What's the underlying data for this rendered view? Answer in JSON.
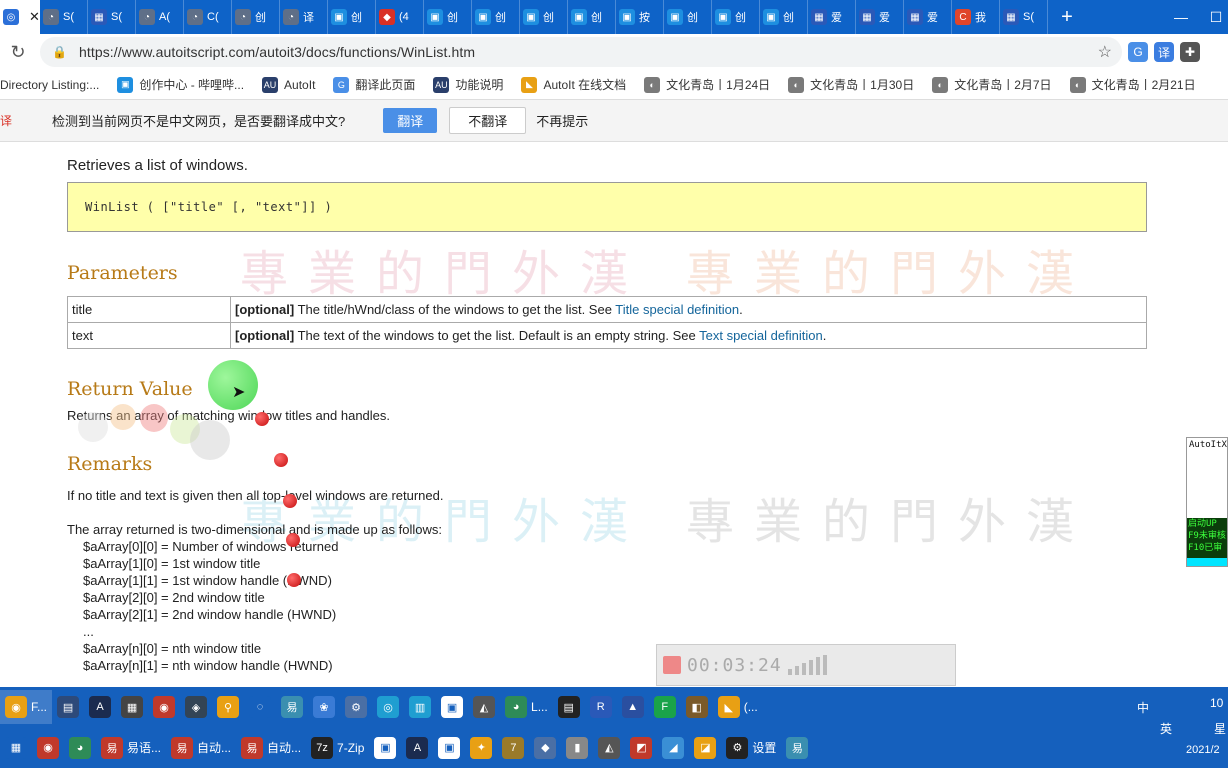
{
  "tabs": [
    {
      "title": "",
      "active": true,
      "color": "#2b6fd8",
      "glyph": "◎",
      "width": 40
    },
    {
      "title": "S(",
      "color": "#5f6f88",
      "glyph": "◔",
      "width": 48
    },
    {
      "title": "S(",
      "color": "#2a59b8",
      "glyph": "▦",
      "width": 48
    },
    {
      "title": "A(",
      "color": "#5f6f88",
      "glyph": "◔",
      "width": 48
    },
    {
      "title": "C(",
      "color": "#5f6f88",
      "glyph": "◔",
      "width": 48
    },
    {
      "title": "创",
      "color": "#5f6f88",
      "glyph": "◔",
      "width": 48
    },
    {
      "title": "译",
      "color": "#5f6f88",
      "glyph": "◔",
      "width": 48
    },
    {
      "title": "创",
      "color": "#1e8fe0",
      "glyph": "▣",
      "width": 48
    },
    {
      "title": "(4",
      "color": "#d93025",
      "glyph": "◆",
      "width": 48
    },
    {
      "title": "创",
      "color": "#1e8fe0",
      "glyph": "▣",
      "width": 48
    },
    {
      "title": "创",
      "color": "#1e8fe0",
      "glyph": "▣",
      "width": 48
    },
    {
      "title": "创",
      "color": "#1e8fe0",
      "glyph": "▣",
      "width": 48
    },
    {
      "title": "创",
      "color": "#1e8fe0",
      "glyph": "▣",
      "width": 48
    },
    {
      "title": "按",
      "color": "#1e8fe0",
      "glyph": "▣",
      "width": 48
    },
    {
      "title": "创",
      "color": "#1e8fe0",
      "glyph": "▣",
      "width": 48
    },
    {
      "title": "创",
      "color": "#1e8fe0",
      "glyph": "▣",
      "width": 48
    },
    {
      "title": "创",
      "color": "#1e8fe0",
      "glyph": "▣",
      "width": 48
    },
    {
      "title": "爱",
      "color": "#2a59b8",
      "glyph": "▦",
      "width": 48
    },
    {
      "title": "爱",
      "color": "#2a59b8",
      "glyph": "▦",
      "width": 48
    },
    {
      "title": "爱",
      "color": "#2a59b8",
      "glyph": "▦",
      "width": 48
    },
    {
      "title": "我",
      "color": "#e0452a",
      "glyph": "C",
      "width": 48
    },
    {
      "title": "S(",
      "color": "#2a59b8",
      "glyph": "▦",
      "width": 48
    }
  ],
  "window_controls": {
    "minimize": "—",
    "maximize": "☐"
  },
  "address": {
    "url": "https://www.autoitscript.com/autoit3/docs/functions/WinList.htm",
    "lock_glyph": "🔒",
    "reload_glyph": "↻",
    "star_glyph": "☆"
  },
  "extensions": [
    {
      "glyph": "G",
      "color": "#4a8fe7"
    },
    {
      "glyph": "译",
      "color": "#3b7de0"
    },
    {
      "glyph": "✚",
      "color": "#555"
    }
  ],
  "bookmarks": [
    {
      "label": "Directory Listing:...",
      "icon": "",
      "color": "#ffffff"
    },
    {
      "label": "创作中心 - 哔哩哔...",
      "icon": "▣",
      "color": "#1e8fe0"
    },
    {
      "label": "AutoIt",
      "icon": "AU",
      "color": "#2a3f6b"
    },
    {
      "label": "翻译此页面",
      "icon": "G",
      "color": "#4a8fe7"
    },
    {
      "label": "功能说明",
      "icon": "AU",
      "color": "#2a3f6b"
    },
    {
      "label": "AutoIt 在线文档",
      "icon": "◣",
      "color": "#e8a014"
    },
    {
      "label": "文化青岛丨1月24日",
      "icon": "◐",
      "color": "#7a7a7a"
    },
    {
      "label": "文化青岛丨1月30日",
      "icon": "◐",
      "color": "#7a7a7a"
    },
    {
      "label": "文化青岛丨2月7日",
      "icon": "◐",
      "color": "#7a7a7a"
    },
    {
      "label": "文化青岛丨2月21日",
      "icon": "◐",
      "color": "#7a7a7a"
    }
  ],
  "translate_bar": {
    "icon_text": "译",
    "message": "检测到当前网页不是中文网页，是否要翻译成中文?",
    "translate": "翻译",
    "dont_translate": "不翻译",
    "never": "不再提示"
  },
  "doc": {
    "description": "Retrieves a list of windows.",
    "syntax": "WinList ( [\"title\" [, \"text\"]] )",
    "parameters_heading": "Parameters",
    "parameters": [
      {
        "name": "title",
        "tag": "[optional]",
        "text": " The title/hWnd/class of the windows to get the list. See ",
        "link": "Title special definition",
        "end": "."
      },
      {
        "name": "text",
        "tag": "[optional]",
        "text": " The text of the windows to get the list. Default is an empty string. See ",
        "link": "Text special definition",
        "end": "."
      }
    ],
    "return_heading": "Return Value",
    "return_text": "Returns an array of matching window titles and handles.",
    "remarks_heading": "Remarks",
    "remarks_1": "If no title and text is given then all top-level windows are returned.",
    "remarks_2": "The array returned is two-dimensional and is made up as follows:",
    "array_lines": [
      "$aArray[0][0] = Number of windows returned",
      "$aArray[1][0] = 1st window title",
      "$aArray[1][1] = 1st window handle (HWND)",
      "$aArray[2][0] = 2nd window title",
      "$aArray[2][1] = 2nd window handle (HWND)",
      "...",
      "$aArray[n][0] = nth window title",
      "$aArray[n][1] = nth window handle (HWND)"
    ]
  },
  "watermark": "專業的門外漢",
  "side_panel": {
    "title": "AutoItX",
    "lines": [
      "启动UP",
      "F9未审核",
      "F10已审"
    ]
  },
  "recorder": {
    "time": "00:03:24"
  },
  "taskbar_row1": [
    {
      "label": "F...",
      "icon": "◉",
      "color": "#e8a014",
      "sel": true
    },
    {
      "label": "",
      "icon": "▤",
      "color": "#2d4a7a"
    },
    {
      "label": "",
      "icon": "A",
      "color": "#1b2b4f"
    },
    {
      "label": "",
      "icon": "▦",
      "color": "#444"
    },
    {
      "label": "",
      "icon": "◉",
      "color": "#c0392b"
    },
    {
      "label": "",
      "icon": "◈",
      "color": "#345"
    },
    {
      "label": "",
      "icon": "⚲",
      "color": "#e8a014"
    },
    {
      "label": "",
      "icon": "◌",
      "color": "#1560bd"
    },
    {
      "label": "",
      "icon": "易",
      "color": "#3a8fb0"
    },
    {
      "label": "",
      "icon": "❀",
      "color": "#3a7bd5"
    },
    {
      "label": "",
      "icon": "⚙",
      "color": "#4a6fa5"
    },
    {
      "label": "",
      "icon": "◎",
      "color": "#1f9ed1"
    },
    {
      "label": "",
      "icon": "▥",
      "color": "#1f9ed1"
    },
    {
      "label": "",
      "icon": "▣",
      "color": "#fff"
    },
    {
      "label": "",
      "icon": "◭",
      "color": "#555"
    },
    {
      "label": "L...",
      "icon": "◕",
      "color": "#2e8b57"
    },
    {
      "label": "",
      "icon": "▤",
      "color": "#222"
    },
    {
      "label": "",
      "icon": "R",
      "color": "#2a59b8"
    },
    {
      "label": "",
      "icon": "▲",
      "color": "#2a4fa0"
    },
    {
      "label": "",
      "icon": "F",
      "color": "#1aa34a"
    },
    {
      "label": "",
      "icon": "◧",
      "color": "#7a5a2a"
    },
    {
      "label": "(...",
      "icon": "◣",
      "color": "#e8a014"
    }
  ],
  "taskbar_row2": [
    {
      "label": "",
      "icon": "▦",
      "color": "#1560bd"
    },
    {
      "label": "",
      "icon": "◉",
      "color": "#c0392b"
    },
    {
      "label": "",
      "icon": "◕",
      "color": "#2e8b57"
    },
    {
      "label": "易语...",
      "icon": "易",
      "color": "#c0392b"
    },
    {
      "label": "自动...",
      "icon": "易",
      "color": "#c0392b"
    },
    {
      "label": "自动...",
      "icon": "易",
      "color": "#c0392b"
    },
    {
      "label": "7-Zip",
      "icon": "7z",
      "color": "#222"
    },
    {
      "label": "",
      "icon": "▣",
      "color": "#fff"
    },
    {
      "label": "",
      "icon": "A",
      "color": "#1b2b4f"
    },
    {
      "label": "",
      "icon": "▣",
      "color": "#fff"
    },
    {
      "label": "",
      "icon": "✦",
      "color": "#e8a014"
    },
    {
      "label": "",
      "icon": "7",
      "color": "#9a7a2a"
    },
    {
      "label": "",
      "icon": "◆",
      "color": "#4a6fa5"
    },
    {
      "label": "",
      "icon": "▮",
      "color": "#888"
    },
    {
      "label": "",
      "icon": "◭",
      "color": "#555"
    },
    {
      "label": "",
      "icon": "◩",
      "color": "#c0392b"
    },
    {
      "label": "",
      "icon": "◢",
      "color": "#3a8fd5"
    },
    {
      "label": "",
      "icon": "◪",
      "color": "#e8a014"
    },
    {
      "label": "设置",
      "icon": "⚙",
      "color": "#222"
    },
    {
      "label": "",
      "icon": "易",
      "color": "#3a8fb0"
    }
  ],
  "tray": {
    "row1_time": "10",
    "row2_date": "2021/2",
    "row1_misc": "星",
    "ime": "英",
    "zh": "中"
  }
}
